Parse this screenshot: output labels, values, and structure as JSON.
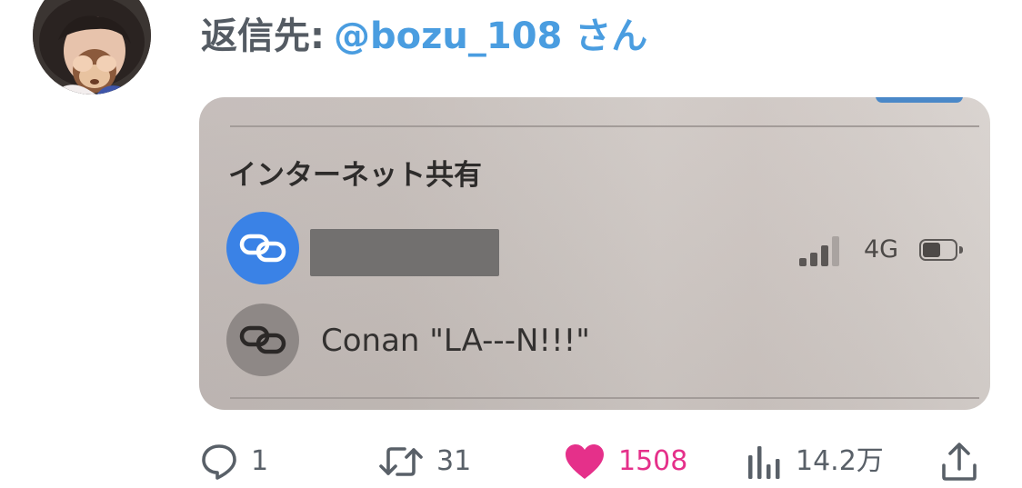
{
  "reply_line": {
    "label": "返信先:",
    "handle": "@bozu_108 さん"
  },
  "avatar": {
    "icon": "avatar"
  },
  "screenshot": {
    "section_title": "インターネット共有",
    "network_label": "4G",
    "other_device_name": "Conan \"LA---N!!!\"",
    "signal_bars_filled": 3,
    "signal_bars_total": 4,
    "battery_level": 0.55,
    "hotspot_icon_color": "#3a82e6"
  },
  "actions": {
    "reply_count": "1",
    "retweet_count": "31",
    "like_count": "1508",
    "views_count": "14.2万"
  },
  "colors": {
    "accent": "#4a9de0",
    "like": "#e5308a",
    "muted": "#596068"
  }
}
